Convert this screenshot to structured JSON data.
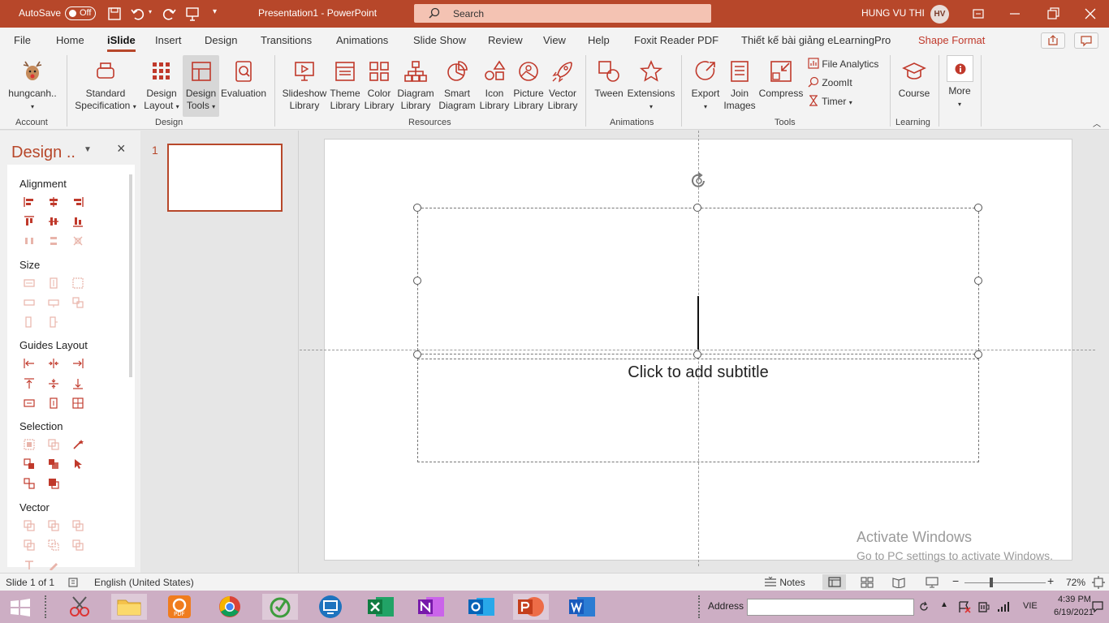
{
  "titlebar": {
    "autosave": "AutoSave",
    "toggle": "Off",
    "doc_title": "Presentation1  -  PowerPoint",
    "search_placeholder": "Search",
    "user_name": "HUNG VU THI",
    "user_initials": "HV"
  },
  "tabs": [
    "File",
    "Home",
    "iSlide",
    "Insert",
    "Design",
    "Transitions",
    "Animations",
    "Slide Show",
    "Review",
    "View",
    "Help",
    "Foxit Reader PDF",
    "Thiết kế bài giảng eLearningPro",
    "Shape Format"
  ],
  "ribbon": {
    "account": {
      "label": "hungcanh..",
      "group": "Account"
    },
    "design": {
      "group": "Design",
      "standard_spec": [
        "Standard",
        "Specification"
      ],
      "design_layout": [
        "Design",
        "Layout"
      ],
      "design_tools": [
        "Design",
        "Tools"
      ],
      "evaluation": "Evaluation"
    },
    "resources": {
      "group": "Resources",
      "items": [
        [
          "Slideshow",
          "Library"
        ],
        [
          "Theme",
          "Library"
        ],
        [
          "Color",
          "Library"
        ],
        [
          "Diagram",
          "Library"
        ],
        [
          "Smart",
          "Diagram"
        ],
        [
          "Icon",
          "Library"
        ],
        [
          "Picture",
          "Library"
        ],
        [
          "Vector",
          "Library"
        ]
      ]
    },
    "animations": {
      "group": "Animations",
      "tween": "Tween",
      "extensions": "Extensions"
    },
    "tools": {
      "group": "Tools",
      "export": "Export",
      "join": [
        "Join",
        "Images"
      ],
      "compress": "Compress",
      "file_analytics": "File Analytics",
      "zoomit": "ZoomIt",
      "timer": "Timer"
    },
    "learning": {
      "group": "Learning",
      "course": "Course"
    },
    "more": "More"
  },
  "pane": {
    "title": "Design ..",
    "sections": [
      "Alignment",
      "Size",
      "Guides Layout",
      "Selection",
      "Vector"
    ]
  },
  "thumbs": {
    "slide_number": "1"
  },
  "slide": {
    "subtitle_placeholder": "Click to add subtitle"
  },
  "watermark": {
    "line1": "Activate Windows",
    "line2": "Go to PC settings to activate Windows."
  },
  "status": {
    "slide_of": "Slide 1 of 1",
    "language": "English (United States)",
    "notes": "Notes",
    "zoom": "72%"
  },
  "taskbar": {
    "address_label": "Address",
    "lang": "VIE",
    "time": "4:39 PM",
    "date": "6/19/2021"
  },
  "colors": {
    "accent": "#b7472a",
    "icon": "#c0392b",
    "taskbar": "#cdaec4"
  }
}
